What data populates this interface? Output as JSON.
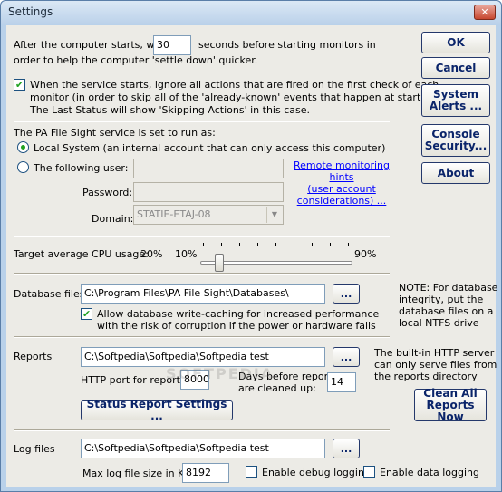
{
  "window": {
    "title": "Settings",
    "close_glyph": "✕"
  },
  "startup": {
    "wait_prefix": "After the computer starts, wait",
    "wait_value": "30",
    "wait_suffix": "seconds before starting monitors in",
    "wait_line2": "order to help the computer 'settle down' quicker.",
    "ignore_checked": true,
    "ignore_line1": "When the service starts, ignore all actions that are fired on the first check of each",
    "ignore_line2": "monitor (in order to skip all of the 'already-known' events that happen at startup).",
    "ignore_line3": "The Last Status will show 'Skipping Actions' in this case."
  },
  "service": {
    "heading": "The PA File Sight service is set to run as:",
    "local_system_label": "Local System (an internal account that can only access this computer)",
    "local_system_selected": true,
    "following_user_label": "The following user:",
    "following_user_selected": false,
    "user_value": "",
    "password_label": "Password:",
    "password_value": "",
    "domain_label": "Domain:",
    "domain_value": "STATIE-ETAJ-08",
    "hint_line1": "Remote monitoring hints",
    "hint_line2": "(user account",
    "hint_line3": "considerations) ..."
  },
  "cpu": {
    "label": "Target average CPU usage:",
    "current": "20%",
    "min_label": "10%",
    "max_label": "90%",
    "slider_value_percent": 20,
    "slider_min": 10,
    "slider_max": 90
  },
  "database": {
    "label": "Database files",
    "path": "C:\\Program Files\\PA File Sight\\Databases\\",
    "browse_label": "...",
    "write_cache_checked": true,
    "write_cache_line1": "Allow database write-caching for increased performance",
    "write_cache_line2": "with the risk of corruption if the power or hardware fails",
    "note_line1": "NOTE: For database",
    "note_line2": "integrity, put the",
    "note_line3": "database files on a",
    "note_line4": "local NTFS drive"
  },
  "reports": {
    "label": "Reports",
    "path": "C:\\Softpedia\\Softpedia\\Softpedia test",
    "browse_label": "...",
    "http_port_label": "HTTP port for reports",
    "http_port_value": "8000",
    "days_line1": "Days before reports",
    "days_line2": "are cleaned up:",
    "days_value": "14",
    "status_button": "Status Report Settings ...",
    "server_line1": "The built-in HTTP server",
    "server_line2": "can only serve files from",
    "server_line3": "the reports directory",
    "clean_button": "Clean All\nReports Now"
  },
  "logs": {
    "label": "Log files",
    "path": "C:\\Softpedia\\Softpedia\\Softpedia test",
    "browse_label": "...",
    "max_size_label": "Max log file size in KB",
    "max_size_value": "8192",
    "debug_label": "Enable debug logging",
    "debug_checked": false,
    "data_label": "Enable data logging",
    "data_checked": false
  },
  "buttons": {
    "ok": "OK",
    "cancel": "Cancel",
    "system_alerts": "System\nAlerts ...",
    "console_security": "Console\nSecurity...",
    "about": "About"
  },
  "watermark": "SOFTPEDIA",
  "check_glyph": "✔",
  "combo_arrow_glyph": "▼"
}
